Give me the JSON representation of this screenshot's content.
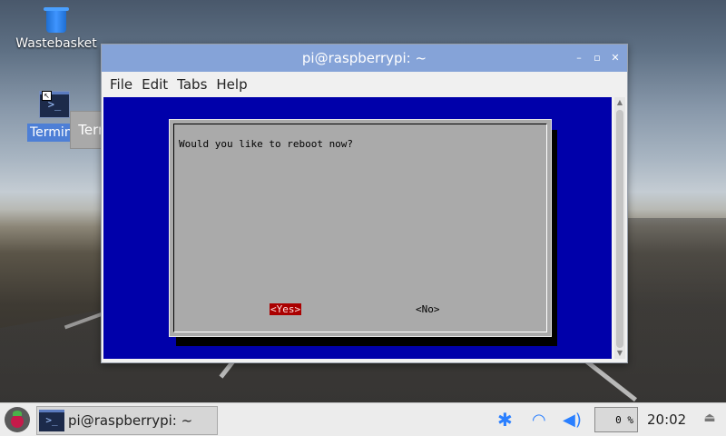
{
  "desktop": {
    "icons": [
      {
        "label": "Wastebasket"
      },
      {
        "label": "Terminal"
      }
    ],
    "tooltip": "Terminal"
  },
  "window": {
    "title": "pi@raspberrypi: ~",
    "controls": {
      "minimize": "–",
      "maximize": "▫",
      "close": "✕"
    },
    "menu": [
      "File",
      "Edit",
      "Tabs",
      "Help"
    ]
  },
  "dialog": {
    "message": "Would you like to reboot now?",
    "yes_label": "<Yes>",
    "no_label": "<No>"
  },
  "taskbar": {
    "task_label": "pi@raspberrypi: ~",
    "cpu": "0 %",
    "clock": "20:02"
  },
  "icons": {
    "bluetooth": "bluetooth-icon",
    "wifi": "wifi-icon",
    "volume": "volume-icon",
    "eject": "eject-icon"
  },
  "colors": {
    "terminal_bg": "#0000aa",
    "dialog_bg": "#aaaaaa",
    "selected_button": "#aa0000",
    "titlebar": "#85a3d8"
  }
}
